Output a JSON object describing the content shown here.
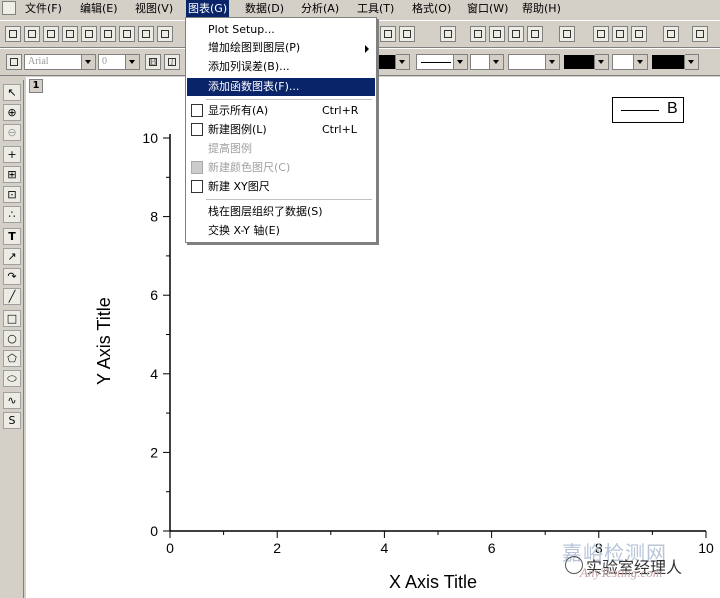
{
  "menubar": {
    "items": [
      "文件(F)",
      "编辑(E)",
      "视图(V)",
      "图表(G)",
      "数据(D)",
      "分析(A)",
      "工具(T)",
      "格式(O)",
      "窗口(W)",
      "帮助(H)"
    ],
    "active_index": 3
  },
  "format_toolbar": {
    "font_name": "Arial",
    "font_size": "0",
    "bold": "B",
    "italic": "I"
  },
  "graph_menu": {
    "items": [
      {
        "label": "Plot Setup...",
        "shortcut": "",
        "state": "normal"
      },
      {
        "label": "增加绘图到图层(P)",
        "shortcut": "",
        "state": "normal",
        "submenu": true
      },
      {
        "label": "添加列误差(B)...",
        "shortcut": "",
        "state": "normal"
      },
      {
        "label": "添加函数图表(F)...",
        "shortcut": "",
        "state": "highlighted"
      },
      {
        "label": "显示所有(A)",
        "shortcut": "Ctrl+R",
        "state": "normal"
      },
      {
        "label": "新建图例(L)",
        "shortcut": "Ctrl+L",
        "state": "normal"
      },
      {
        "label": "提高图例",
        "shortcut": "",
        "state": "disabled"
      },
      {
        "label": "新建颜色图尺(C)",
        "shortcut": "",
        "state": "disabled"
      },
      {
        "label": "新建  XY图尺",
        "shortcut": "",
        "state": "normal"
      },
      {
        "label": "栈在图层组织了数据(S)",
        "shortcut": "",
        "state": "normal"
      },
      {
        "label": "交换 X-Y 轴(E)",
        "shortcut": "",
        "state": "normal"
      }
    ]
  },
  "graph": {
    "layer_number": "1",
    "legend_entry": "B",
    "x_title": "X Axis Title",
    "y_title": "Y Axis Title"
  },
  "chart_data": {
    "type": "line",
    "title": "",
    "xlabel": "X Axis Title",
    "ylabel": "Y Axis Title",
    "xlim": [
      0,
      10
    ],
    "ylim": [
      0,
      10
    ],
    "x_ticks": [
      "0",
      "2",
      "4",
      "6",
      "8",
      "10"
    ],
    "y_ticks": [
      "0",
      "2",
      "4",
      "6",
      "8",
      "10"
    ],
    "series": [
      {
        "name": "B",
        "values": []
      }
    ],
    "legend": "top-right",
    "grid": false
  },
  "watermark": {
    "line1": "嘉峪检测网",
    "line2": "实验室经理人",
    "line3": "AnyTesting.com"
  }
}
